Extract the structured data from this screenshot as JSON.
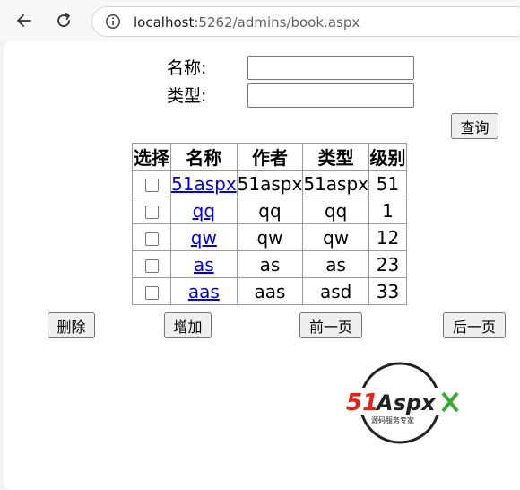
{
  "browser": {
    "url_host": "localhost",
    "url_path": ":5262/admins/book.aspx"
  },
  "search_form": {
    "name_label": "名称:",
    "type_label": "类型:",
    "name_value": "",
    "type_value": "",
    "query_button": "查询"
  },
  "table": {
    "headers": [
      "选择",
      "名称",
      "作者",
      "类型",
      "级别"
    ],
    "rows": [
      {
        "name": "51aspx",
        "author": "51aspx",
        "type": "51aspx",
        "level": "51"
      },
      {
        "name": "qq",
        "author": "qq",
        "type": "qq",
        "level": "1"
      },
      {
        "name": "qw",
        "author": "qw",
        "type": "qw",
        "level": "12"
      },
      {
        "name": "as",
        "author": "as",
        "type": "as",
        "level": "23"
      },
      {
        "name": "aas",
        "author": "aas",
        "type": "asd",
        "level": "33"
      }
    ]
  },
  "actions": {
    "delete": "删除",
    "add": "增加",
    "prev": "前一页",
    "next": "后一页"
  },
  "logo": {
    "brand_number": "51",
    "brand_name": "Aspx",
    "slogan": "源码服务专家",
    "colors": {
      "red": "#e2231a",
      "green": "#3aaa35",
      "dark": "#222222"
    }
  }
}
